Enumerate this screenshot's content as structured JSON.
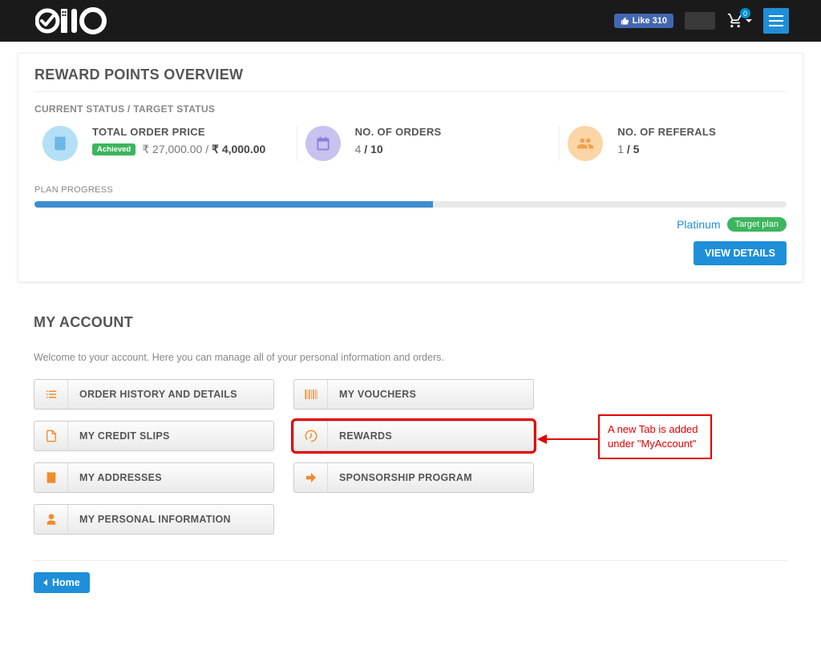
{
  "header": {
    "fb_like_text": "Like 310",
    "cart_badge": "0"
  },
  "overview": {
    "title": "REWARD POINTS OVERVIEW",
    "status_label": "CURRENT STATUS / TARGET STATUS",
    "stats": {
      "total_price": {
        "title": "TOTAL ORDER PRICE",
        "achieved": "Achieved",
        "current": "₹ 27,000.00",
        "sep": " / ",
        "target": "₹ 4,000.00"
      },
      "orders": {
        "title": "NO. OF ORDERS",
        "current": "4",
        "sep": " / ",
        "target": "10"
      },
      "referrals": {
        "title": "NO. OF REFERALS",
        "current": "1",
        "sep": " / ",
        "target": "5"
      }
    },
    "plan_progress_label": "PLAN PROGRESS",
    "progress_percent": 53,
    "plan_name": "Platinum",
    "target_plan_badge": "Target plan",
    "view_details": "VIEW DETAILS"
  },
  "account": {
    "title": "MY ACCOUNT",
    "welcome": "Welcome to your account. Here you can manage all of your personal information and orders.",
    "tiles": {
      "history": "ORDER HISTORY AND DETAILS",
      "vouchers": "MY VOUCHERS",
      "credit": "MY CREDIT SLIPS",
      "rewards": "REWARDS",
      "addresses": "MY ADDRESSES",
      "sponsorship": "SPONSORSHIP PROGRAM",
      "personal": "MY PERSONAL INFORMATION"
    },
    "annotation": "A new Tab is added under \"MyAccount\"",
    "home_btn": "Home"
  }
}
